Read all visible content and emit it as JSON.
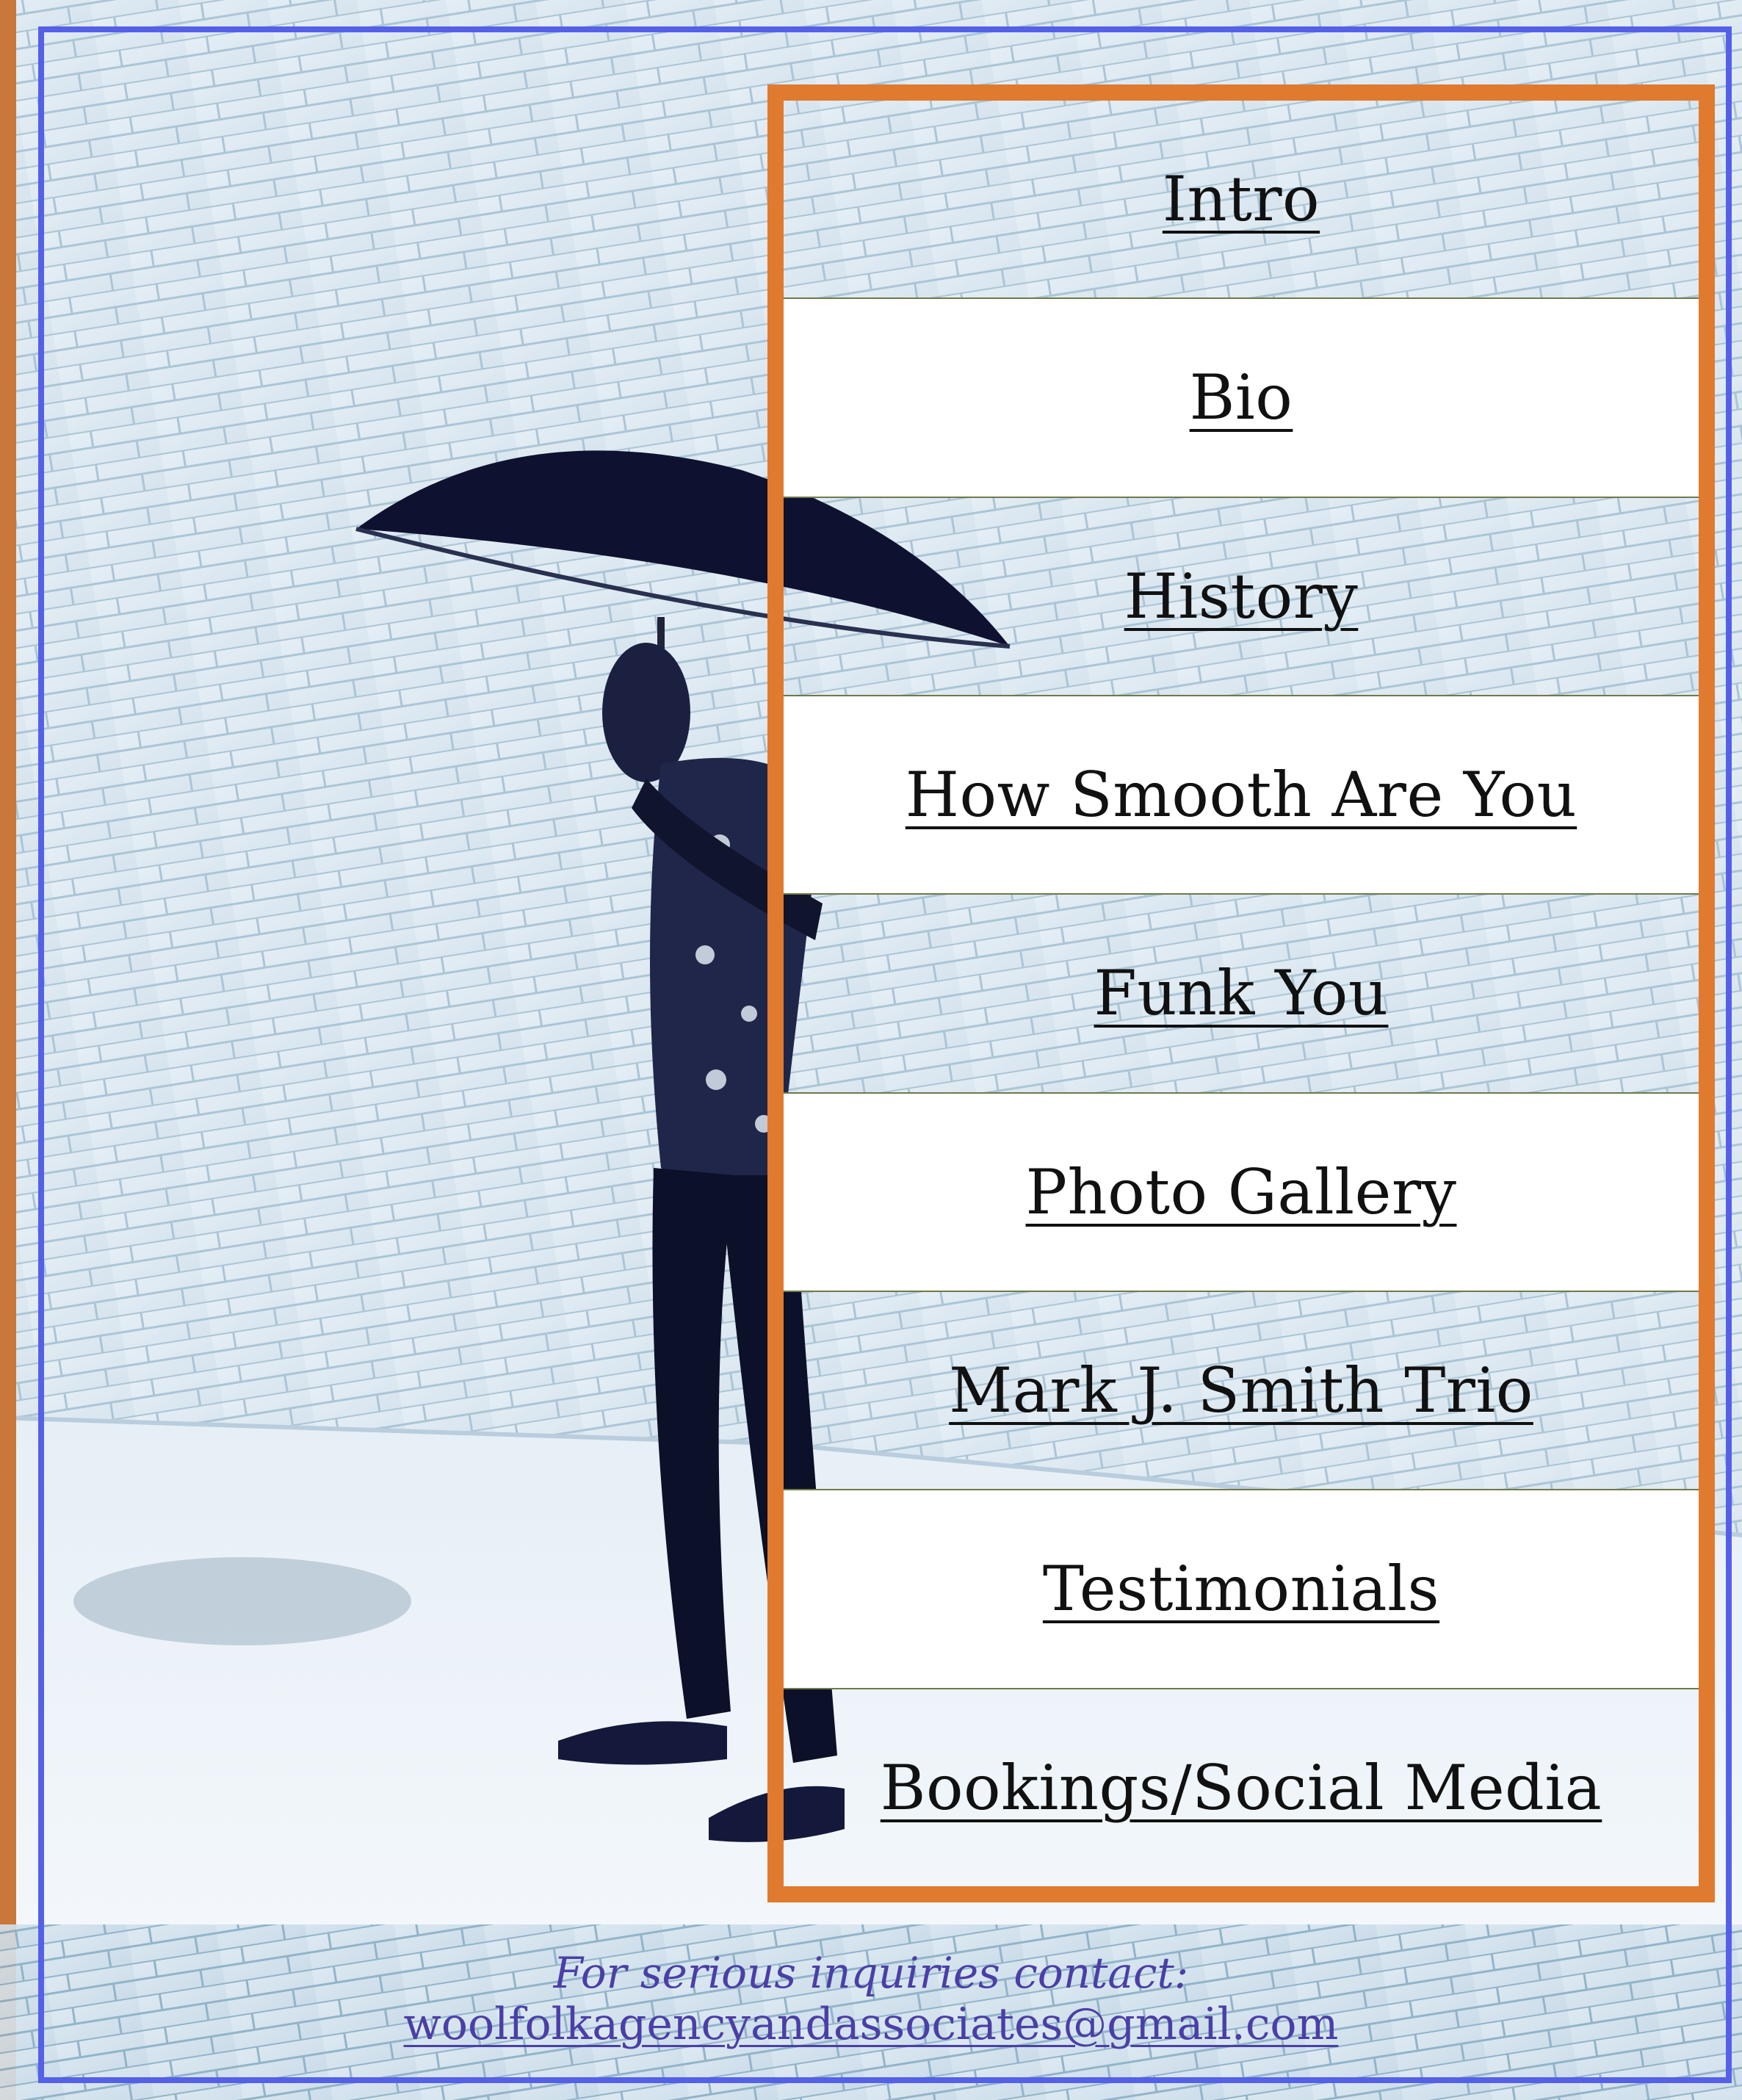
{
  "nav": {
    "items": [
      {
        "label": "Intro"
      },
      {
        "label": "Bio"
      },
      {
        "label": "History"
      },
      {
        "label": "How Smooth Are You"
      },
      {
        "label": "Funk You"
      },
      {
        "label": "Photo Gallery"
      },
      {
        "label": "Mark J. Smith Trio"
      },
      {
        "label": "Testimonials"
      },
      {
        "label": "Bookings/Social Media"
      }
    ]
  },
  "contact": {
    "prefix": "For serious inquiries contact:",
    "email": "woolfolkagencyandassociates@gmail.com"
  },
  "colors": {
    "frame_blue": "#5560e8",
    "panel_orange": "#e07a2e",
    "contact_purple": "#4a3fa6"
  }
}
